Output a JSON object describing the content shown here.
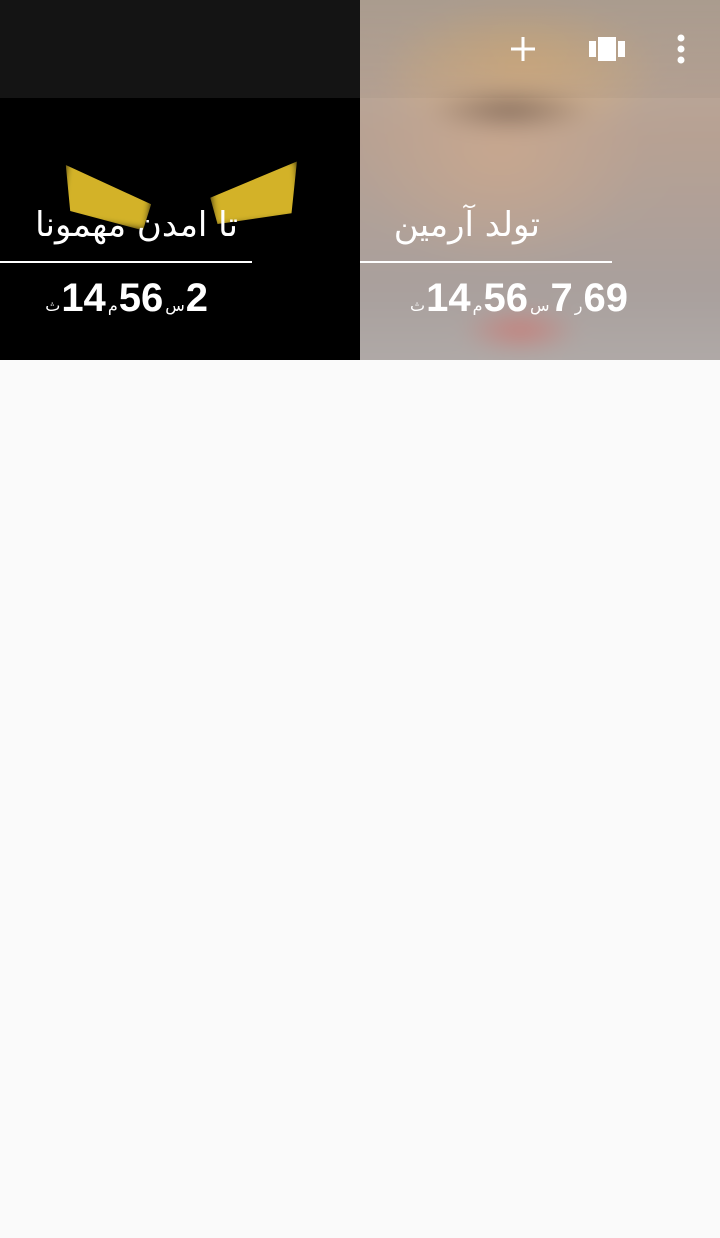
{
  "toolbar": {
    "add_icon": "plus-icon",
    "view_icon": "view-carousel-icon",
    "more_icon": "more-vertical-icon"
  },
  "events": [
    {
      "title": "تا امدن مهمونا",
      "counter": [
        {
          "value": "2",
          "unit": "س"
        },
        {
          "value": "56",
          "unit": "م"
        },
        {
          "value": "14",
          "unit": "ث"
        }
      ]
    },
    {
      "title": "تولد آرمین",
      "counter": [
        {
          "value": "69",
          "unit": "ر"
        },
        {
          "value": "7",
          "unit": "س"
        },
        {
          "value": "56",
          "unit": "م"
        },
        {
          "value": "14",
          "unit": "ث"
        }
      ]
    }
  ],
  "colors": {
    "background": "#fafafa",
    "tile_dark": "#000000",
    "appbar_dark": "#141414",
    "eyes_yellow": "#e5c22c",
    "text": "#ffffff"
  }
}
